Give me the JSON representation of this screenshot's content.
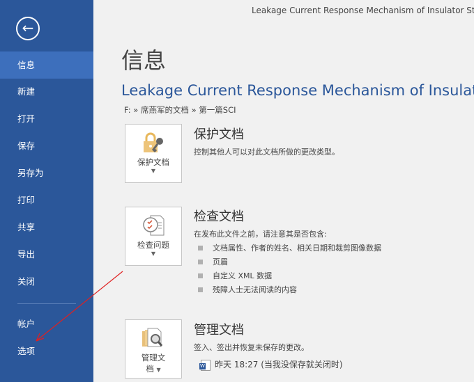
{
  "window_title": "Leakage Current Response Mechanism of Insulator Stri",
  "sidebar": {
    "items": [
      {
        "label": "信息"
      },
      {
        "label": "新建"
      },
      {
        "label": "打开"
      },
      {
        "label": "保存"
      },
      {
        "label": "另存为"
      },
      {
        "label": "打印"
      },
      {
        "label": "共享"
      },
      {
        "label": "导出"
      },
      {
        "label": "关闭"
      },
      {
        "label": "帐户"
      },
      {
        "label": "选项"
      }
    ]
  },
  "page_title": "信息",
  "doc_title": "Leakage Current Response Mechanism of Insulato",
  "path": "F: » 席燕军的文档 » 第一篇SCI",
  "protect": {
    "button": "保护文档",
    "title": "保护文档",
    "desc": "控制其他人可以对此文档所做的更改类型。"
  },
  "inspect": {
    "button": "检查问题",
    "title": "检查文档",
    "desc": "在发布此文件之前，请注意其是否包含:",
    "items": [
      "文档属性、作者的姓名、相关日期和裁剪图像数据",
      "页眉",
      "自定义 XML 数据",
      "残障人士无法阅读的内容"
    ]
  },
  "manage": {
    "button_line1": "管理文",
    "button_line2": "档",
    "title": "管理文档",
    "desc": "签入、签出并恢复未保存的更改。",
    "version": "昨天 18:27 (当我没保存就关闭时)"
  }
}
